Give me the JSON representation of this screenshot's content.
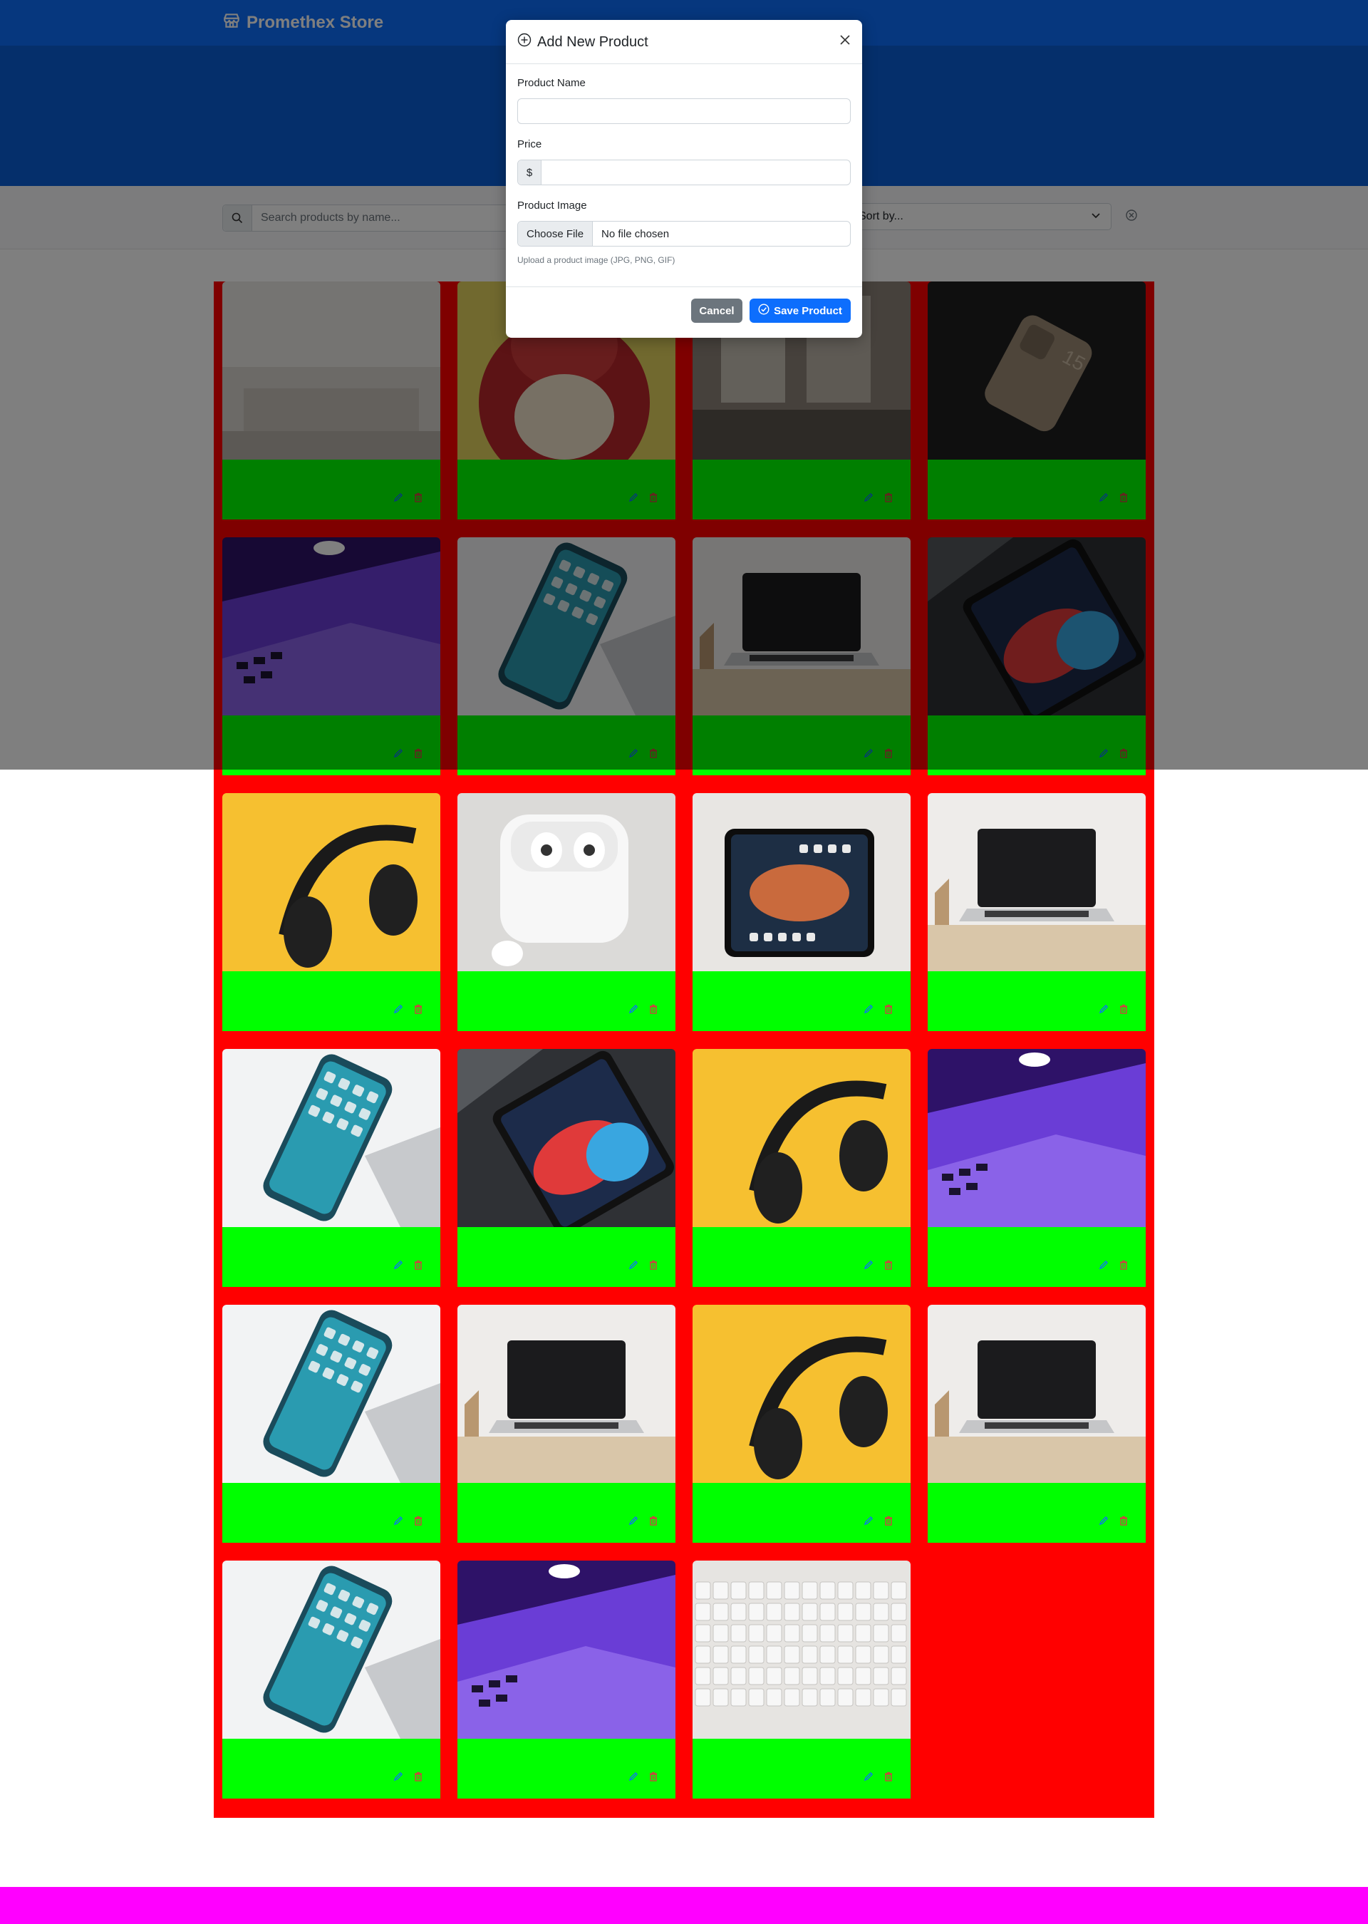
{
  "navbar": {
    "brand": "Promethex Store",
    "brand_icon": "store-icon",
    "color": "#0d6efd"
  },
  "filters": {
    "search_placeholder": "Search products by name...",
    "sort_placeholder": "Sort by..."
  },
  "products": [
    {
      "image": "blurred-room"
    },
    {
      "image": "red-toy"
    },
    {
      "image": "blurred-window"
    },
    {
      "image": "iphone-15-back"
    },
    {
      "image": "purple-laptop"
    },
    {
      "image": "iphone-home-screen"
    },
    {
      "image": "macbook-on-desk"
    },
    {
      "image": "ipad-dark"
    },
    {
      "image": "headphones-yellow"
    },
    {
      "image": "airpods-pro"
    },
    {
      "image": "ipad-in-hand"
    },
    {
      "image": "macbook-on-desk"
    },
    {
      "image": "iphone-home-screen"
    },
    {
      "image": "ipad-dark"
    },
    {
      "image": "headphones-yellow"
    },
    {
      "image": "purple-laptop"
    },
    {
      "image": "iphone-home-screen"
    },
    {
      "image": "macbook-on-desk"
    },
    {
      "image": "headphones-yellow"
    },
    {
      "image": "macbook-on-desk"
    },
    {
      "image": "iphone-home-screen"
    },
    {
      "image": "purple-laptop"
    },
    {
      "image": "keyboard"
    }
  ],
  "modal": {
    "title": "Add New Product",
    "name_label": "Product Name",
    "price_label": "Price",
    "currency_symbol": "$",
    "image_label": "Product Image",
    "file_button": "Choose File",
    "file_status": "No file chosen",
    "help_text": "Upload a product image (JPG, PNG, GIF)",
    "cancel_label": "Cancel",
    "save_label": "Save Product"
  },
  "colors": {
    "grid_background": "#ff0000",
    "card_body": "#00ff00",
    "footer": "#ff00ff",
    "edit": "#0d6efd",
    "delete": "#dc3545"
  }
}
